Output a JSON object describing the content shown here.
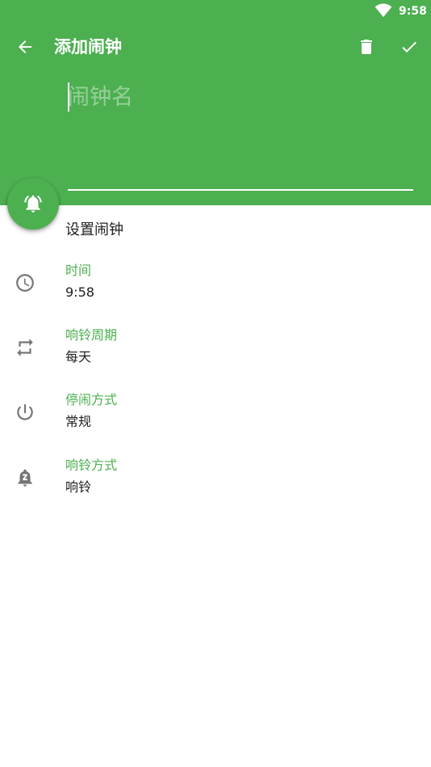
{
  "status_bar": {
    "time": "9:58",
    "wifi_icon": "wifi-icon"
  },
  "toolbar": {
    "back_icon": "arrow-back-icon",
    "title": "添加闹钟",
    "delete_icon": "delete-icon",
    "confirm_icon": "check-icon"
  },
  "name_field": {
    "value": "",
    "placeholder": "闹钟名"
  },
  "fab": {
    "icon": "alarm-ringing-icon"
  },
  "section": {
    "title": "设置闹钟"
  },
  "settings": [
    {
      "icon": "clock-icon",
      "label": "时间",
      "value": "9:58"
    },
    {
      "icon": "repeat-icon",
      "label": "响铃周期",
      "value": "每天"
    },
    {
      "icon": "power-icon",
      "label": "停闹方式",
      "value": "常规"
    },
    {
      "icon": "snooze-bell-icon",
      "label": "响铃方式",
      "value": "响铃"
    }
  ],
  "colors": {
    "primary": "#4caf50",
    "accent_text": "#4caf50",
    "icon_gray": "#757575",
    "text_primary": "#212121"
  }
}
